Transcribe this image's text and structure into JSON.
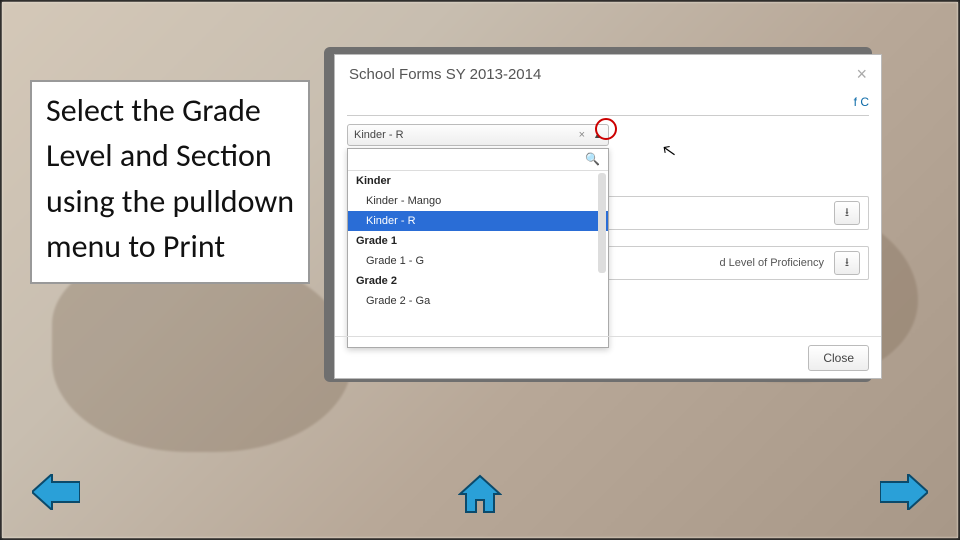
{
  "instruction": "Select the Grade Level and Section using the pulldown menu to Print",
  "modal": {
    "title": "School Forms SY 2013-2014",
    "tab_right": "f C",
    "selected_value": "Kinder - R",
    "search_placeholder": "",
    "groups": [
      {
        "label": "Kinder",
        "items": [
          "Kinder - Mango",
          "Kinder - R"
        ]
      },
      {
        "label": "Grade 1",
        "items": [
          "Grade 1 - G"
        ]
      },
      {
        "label": "Grade 2",
        "items": [
          "Grade 2 - Ga"
        ]
      }
    ],
    "highlighted": "Kinder - R",
    "row2_text": "d Level of Proficiency",
    "close_label": "Close"
  },
  "nav": {
    "prev": "Previous",
    "home": "Home",
    "next": "Next"
  }
}
